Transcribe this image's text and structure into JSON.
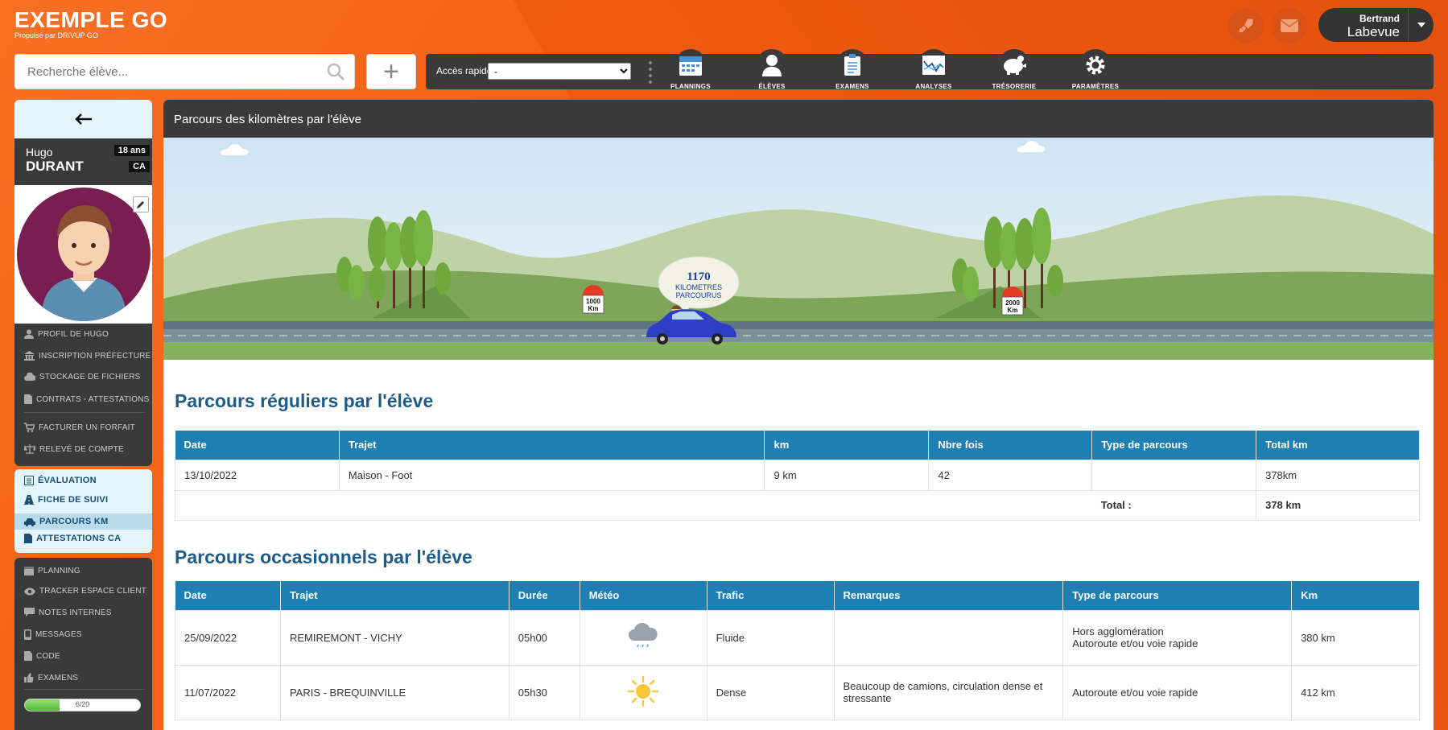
{
  "brand": {
    "name": "EXEMPLE GO",
    "sub": "Propulsé par DRIVUP GO"
  },
  "user": {
    "first": "Bertrand",
    "last": "Labevue"
  },
  "search": {
    "placeholder": "Recherche élève..."
  },
  "add_label": "+",
  "quick_access": {
    "label": "Accès rapides",
    "selected": "-"
  },
  "nav": [
    {
      "label": "PLANNINGS",
      "icon": "calendar-icon"
    },
    {
      "label": "ÉLÈVES",
      "icon": "student-icon"
    },
    {
      "label": "EXAMENS",
      "icon": "clipboard-icon"
    },
    {
      "label": "ANALYSES",
      "icon": "chart-icon"
    },
    {
      "label": "TRÉSORERIE",
      "icon": "piggy-bank-icon"
    },
    {
      "label": "PARAMÈTRES",
      "icon": "settings-icon"
    }
  ],
  "student": {
    "first": "Hugo",
    "last": "DURANT",
    "age": "18 ans",
    "category": "CA"
  },
  "menu1": [
    {
      "label": "PROFIL DE HUGO",
      "icon": "user-icon"
    },
    {
      "label": "INSCRIPTION PRÉFECTURE",
      "icon": "bank-icon"
    },
    {
      "label": "STOCKAGE DE FICHIERS",
      "icon": "cloud-icon"
    },
    {
      "label": "CONTRATS - ATTESTATIONS",
      "icon": "document-icon"
    },
    {
      "label": "FACTURER UN FORFAIT",
      "icon": "cart-icon"
    },
    {
      "label": "RELEVÉ DE COMPTE",
      "icon": "scale-icon"
    }
  ],
  "menu2": [
    {
      "label": "ÉVALUATION",
      "icon": "list-icon"
    },
    {
      "label": "FICHE DE SUIVI",
      "icon": "road-icon"
    },
    {
      "label": "PARCOURS KM",
      "icon": "car-icon"
    },
    {
      "label": "ATTESTATIONS CA",
      "icon": "file-icon"
    }
  ],
  "menu3": [
    {
      "label": "PLANNING",
      "icon": "calendar-icon"
    },
    {
      "label": "TRACKER ESPACE CLIENT",
      "icon": "eye-icon"
    },
    {
      "label": "NOTES INTERNES",
      "icon": "comment-icon"
    },
    {
      "label": "MESSAGES",
      "icon": "phone-icon"
    },
    {
      "label": "CODE",
      "icon": "code-icon"
    },
    {
      "label": "EXAMENS",
      "icon": "thumb-up-icon"
    }
  ],
  "progress": {
    "text": "6/20",
    "value": 0.3
  },
  "main": {
    "header": "Parcours des kilomètres par l'élève",
    "scene": {
      "km": "1170",
      "km_line1": "KILOMETRES",
      "km_line2": "PARCOURUS",
      "marker_left": "1000",
      "marker_right": "2000",
      "marker_unit": "Km"
    },
    "regular": {
      "title": "Parcours réguliers par l'élève",
      "headers": [
        "Date",
        "Trajet",
        "km",
        "Nbre fois",
        "Type de parcours",
        "Total km"
      ],
      "rows": [
        [
          "13/10/2022",
          "Maison - Foot",
          "9 km",
          "42",
          "",
          "378km"
        ]
      ],
      "total_label": "Total :",
      "total_value": "378 km"
    },
    "occasional": {
      "title": "Parcours occasionnels par l'élève",
      "headers": [
        "Date",
        "Trajet",
        "Durée",
        "Météo",
        "Trafic",
        "Remarques",
        "Type de parcours",
        "Km"
      ],
      "rows": [
        {
          "date": "25/09/2022",
          "trajet": "REMIREMONT - VICHY",
          "duree": "05h00",
          "meteo": "rain-cloud-icon",
          "trafic": "Fluide",
          "remarques": "",
          "type1": "Hors agglomération",
          "type2": "Autoroute et/ou voie rapide",
          "km": "380 km"
        },
        {
          "date": "11/07/2022",
          "trajet": "PARIS - BREQUINVILLE",
          "duree": "05h30",
          "meteo": "sun-icon",
          "trafic": "Dense",
          "remarques": "Beaucoup de camions, circulation dense et stressante",
          "type1": "Autoroute et/ou voie rapide",
          "type2": "",
          "km": "412 km"
        }
      ]
    }
  }
}
